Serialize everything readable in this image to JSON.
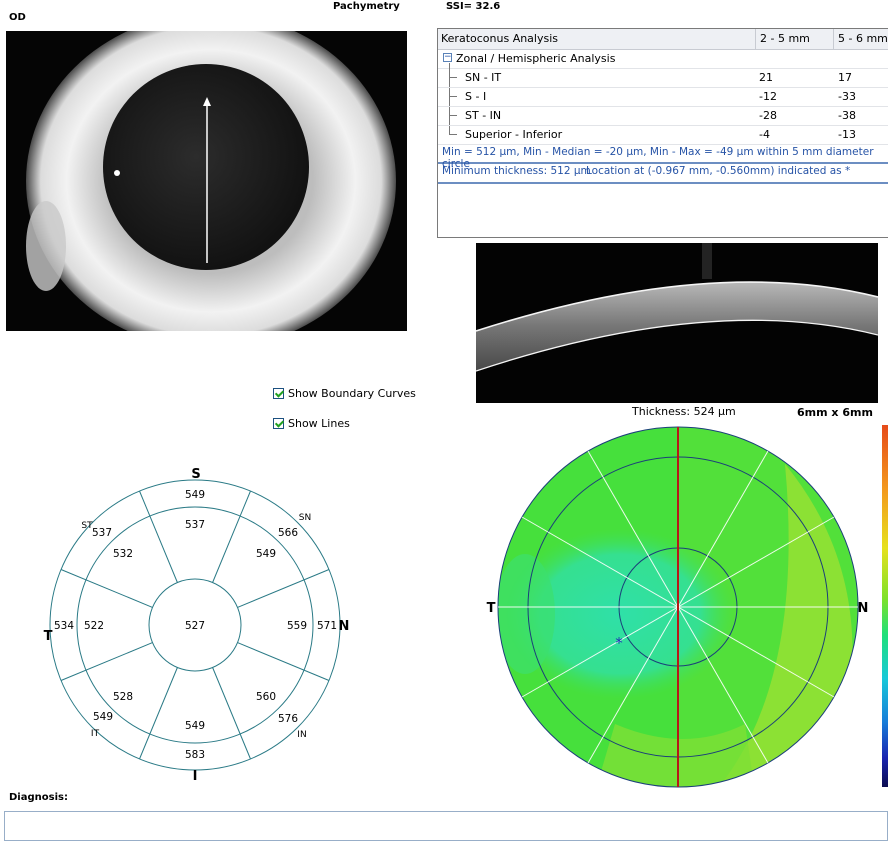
{
  "header": {
    "eye": "OD",
    "title": "Pachymetry",
    "ssi": "SSI= 32.6"
  },
  "table": {
    "header": [
      "Keratoconus Analysis",
      "2 - 5 mm",
      "5 - 6 mm"
    ],
    "group_label": "Zonal / Hemispheric Analysis",
    "group_toggle": "−",
    "rows": [
      {
        "label": "SN - IT",
        "v1": "21",
        "v2": "17"
      },
      {
        "label": "S - I",
        "v1": "-12",
        "v2": "-33"
      },
      {
        "label": "ST - IN",
        "v1": "-28",
        "v2": "-38"
      },
      {
        "label": "Superior - Inferior",
        "v1": "-4",
        "v2": "-13"
      }
    ],
    "min_line": "Min = 512 µm, Min - Median = -20 µm, Min - Max = -49 µm within 5 mm diameter circle",
    "min_thickness": "Minimum thickness: 512 µm",
    "location": "Location at (-0.967 mm, -0.560mm) indicated as *"
  },
  "controls": {
    "show_boundary_curves": "Show Boundary Curves",
    "show_lines": "Show Lines"
  },
  "map_info": {
    "thickness": "Thickness: 524 µm",
    "size": "6mm x 6mm"
  },
  "sector_map": {
    "dir_s": "S",
    "dir_i": "I",
    "dir_t": "T",
    "dir_n": "N",
    "sub_st": "ST",
    "sub_sn": "SN",
    "sub_it": "IT",
    "sub_in": "IN",
    "center": "527",
    "inner": {
      "s": "537",
      "sn": "549",
      "n": "559",
      "in": "560",
      "i": "549",
      "it": "528",
      "t": "522",
      "st": "532"
    },
    "outer": {
      "s": "549",
      "sn": "566",
      "n": "571",
      "in": "576",
      "i": "583",
      "it": "549",
      "t": "534",
      "st": "537"
    }
  },
  "color_map": {
    "dir_t": "T",
    "dir_n": "N",
    "min_marker": "*"
  },
  "diagnosis": {
    "label": "Diagnosis:"
  },
  "colors": {
    "sector_lines": "#2a7a86",
    "map_green": "#46e03c",
    "map_light": "#96e034",
    "map_cyan": "#2ee0a0",
    "vertical_axis": "#b81818"
  }
}
